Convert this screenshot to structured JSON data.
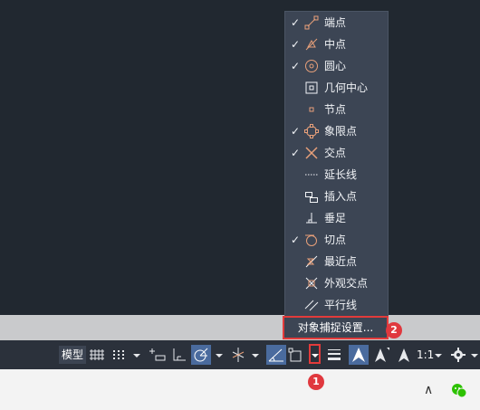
{
  "osnap_menu": {
    "items": [
      {
        "label": "端点",
        "checked": true,
        "icon": "endpoint-icon"
      },
      {
        "label": "中点",
        "checked": true,
        "icon": "midpoint-icon"
      },
      {
        "label": "圆心",
        "checked": true,
        "icon": "center-icon"
      },
      {
        "label": "几何中心",
        "checked": false,
        "icon": "geometric-center-icon"
      },
      {
        "label": "节点",
        "checked": false,
        "icon": "node-icon"
      },
      {
        "label": "象限点",
        "checked": true,
        "icon": "quadrant-icon"
      },
      {
        "label": "交点",
        "checked": true,
        "icon": "intersection-icon"
      },
      {
        "label": "延长线",
        "checked": false,
        "icon": "extension-icon"
      },
      {
        "label": "插入点",
        "checked": false,
        "icon": "insertion-icon"
      },
      {
        "label": "垂足",
        "checked": false,
        "icon": "perpendicular-icon"
      },
      {
        "label": "切点",
        "checked": true,
        "icon": "tangent-icon"
      },
      {
        "label": "最近点",
        "checked": false,
        "icon": "nearest-icon"
      },
      {
        "label": "外观交点",
        "checked": false,
        "icon": "apparent-intersection-icon"
      },
      {
        "label": "平行线",
        "checked": false,
        "icon": "parallel-icon"
      }
    ],
    "settings_label": "对象捕捉设置...",
    "check_glyph": "✓"
  },
  "status_bar": {
    "model_label": "模型",
    "scale_label": "1:1"
  },
  "badges": {
    "one": "1",
    "two": "2"
  },
  "taskbar": {
    "up_arrow": "∧"
  },
  "colors": {
    "accent": "#4a6b9e",
    "highlight": "#e23b3b",
    "snap_icon": "#e8a07a"
  }
}
